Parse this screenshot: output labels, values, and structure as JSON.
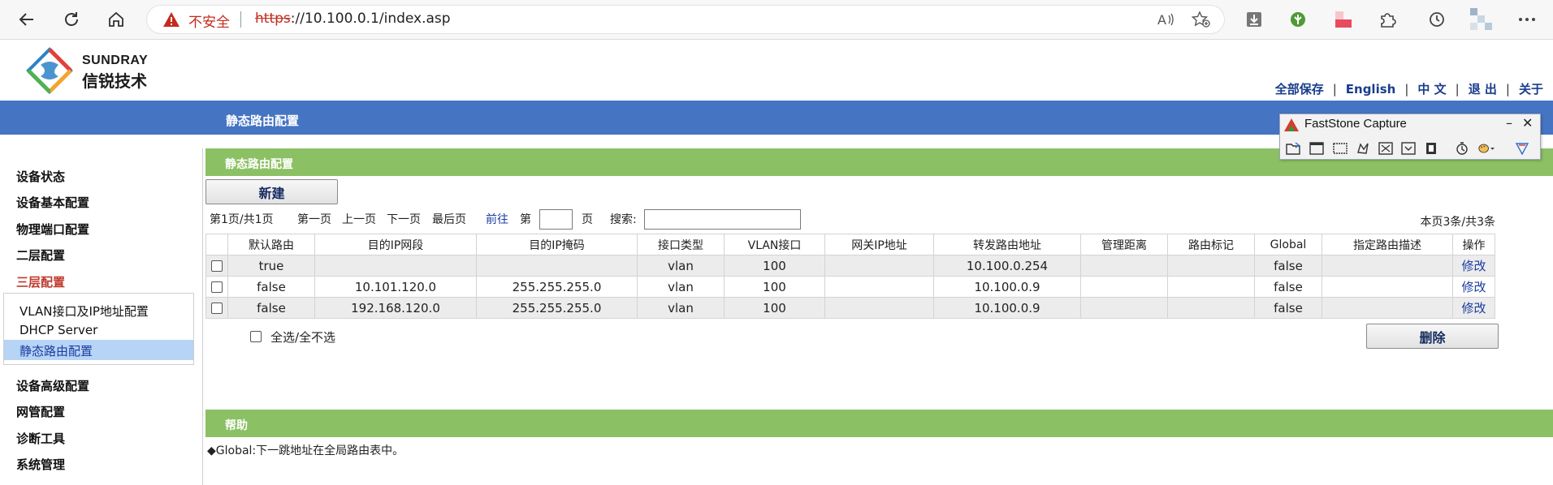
{
  "browser": {
    "insecure_label": "不安全",
    "url_proto": "https",
    "url_rest": "://10.100.0.1/index.asp"
  },
  "brand": {
    "en": "SUNDRAY",
    "cn": "信锐技术"
  },
  "toplinks": [
    "全部保存",
    "English",
    "中 文",
    "退 出",
    "关于"
  ],
  "header_title": "静态路由配置",
  "sidebar": {
    "items": [
      "设备状态",
      "设备基本配置",
      "物理端口配置",
      "二层配置",
      "三层配置",
      "设备高级配置",
      "网管配置",
      "诊断工具",
      "系统管理"
    ],
    "active_item": "三层配置",
    "subitems": [
      "VLAN接口及IP地址配置",
      "DHCP Server",
      "静态路由配置"
    ],
    "selected_subitem": "静态路由配置"
  },
  "section_title": "静态路由配置",
  "new_button": "新建",
  "pager": {
    "summary": "第1页/共1页",
    "first": "第一页",
    "prev": "上一页",
    "next": "下一页",
    "last": "最后页",
    "goto": "前往",
    "page_prefix": "第",
    "page_suffix": "页",
    "search_label": "搜索:",
    "count": "本页3条/共3条"
  },
  "table": {
    "headers": [
      "",
      "默认路由",
      "目的IP网段",
      "目的IP掩码",
      "接口类型",
      "VLAN接口",
      "网关IP地址",
      "转发路由地址",
      "管理距离",
      "路由标记",
      "Global",
      "指定路由描述",
      "操作"
    ],
    "rows": [
      [
        "true",
        "",
        "",
        "vlan",
        "100",
        "",
        "10.100.0.254",
        "",
        "",
        "false",
        "",
        "修改"
      ],
      [
        "false",
        "10.101.120.0",
        "255.255.255.0",
        "vlan",
        "100",
        "",
        "10.100.0.9",
        "",
        "",
        "false",
        "",
        "修改"
      ],
      [
        "false",
        "192.168.120.0",
        "255.255.255.0",
        "vlan",
        "100",
        "",
        "10.100.0.9",
        "",
        "",
        "false",
        "",
        "修改"
      ]
    ]
  },
  "select_all_label": "全选/全不选",
  "delete_button": "删除",
  "help_title": "帮助",
  "help_text": "◆Global:下一跳地址在全局路由表中。",
  "faststone": {
    "title": "FastStone Capture",
    "minimize": "–",
    "close": "✕"
  },
  "colors": {
    "header_blue": "#4574c3",
    "section_green": "#8cc064",
    "active_red": "#c0392b",
    "selected_bg": "#b7d3f5"
  }
}
